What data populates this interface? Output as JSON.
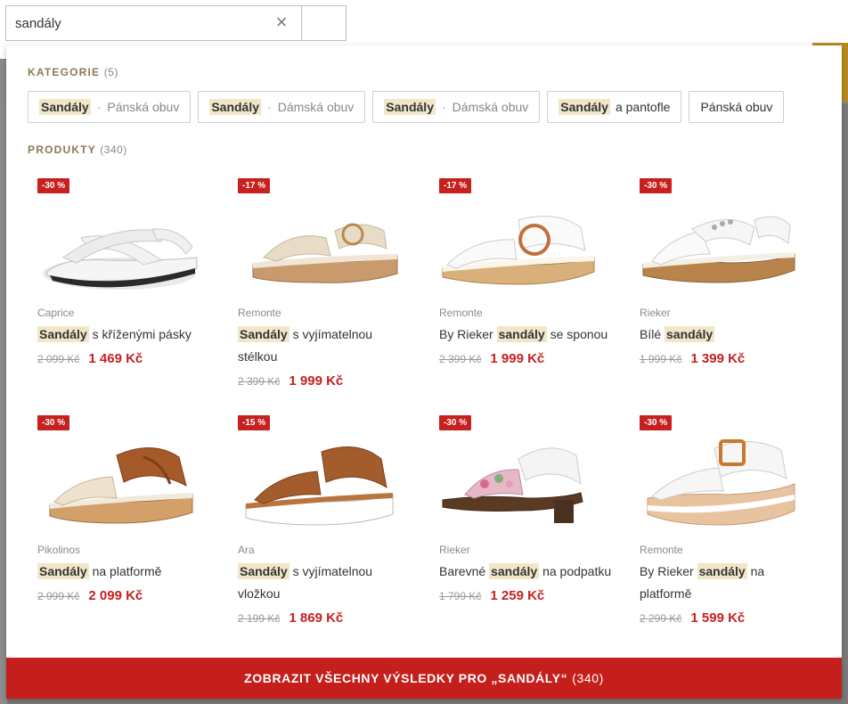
{
  "search": {
    "value": "sandály",
    "clear_icon": "×"
  },
  "categories": {
    "title": "KATEGORIE",
    "count": "(5)",
    "items": [
      {
        "highlight": "Sandály",
        "rest": "",
        "sub": "Pánská obuv"
      },
      {
        "highlight": "Sandály",
        "rest": "",
        "sub": "Dámská obuv"
      },
      {
        "highlight": "Sandály",
        "rest": "",
        "sub": "Dámská obuv"
      },
      {
        "highlight": "Sandály",
        "rest": "a pantofle",
        "sub": ""
      },
      {
        "highlight": "",
        "rest": "Pánská obuv",
        "sub": ""
      }
    ]
  },
  "products": {
    "title": "PRODUKTY",
    "count": "(340)",
    "items": [
      {
        "badge": "-30 %",
        "brand": "Caprice",
        "pre": "",
        "hl": "Sandály",
        "post": " s kříženými pásky",
        "old": "2 099 Kč",
        "new": "1 469 Kč"
      },
      {
        "badge": "-17 %",
        "brand": "Remonte",
        "pre": "",
        "hl": "Sandály",
        "post": " s vyjímatelnou stélkou",
        "old": "2 399 Kč",
        "new": "1 999 Kč"
      },
      {
        "badge": "-17 %",
        "brand": "Remonte",
        "pre": "By Rieker ",
        "hl": "sandály",
        "post": " se sponou",
        "old": "2 399 Kč",
        "new": "1 999 Kč"
      },
      {
        "badge": "-30 %",
        "brand": "Rieker",
        "pre": "Bílé ",
        "hl": "sandály",
        "post": "",
        "old": "1 999 Kč",
        "new": "1 399 Kč"
      },
      {
        "badge": "-30 %",
        "brand": "Pikolinos",
        "pre": "",
        "hl": "Sandály",
        "post": " na platformě",
        "old": "2 999 Kč",
        "new": "2 099 Kč"
      },
      {
        "badge": "-15 %",
        "brand": "Ara",
        "pre": "",
        "hl": "Sandály",
        "post": " s vyjímatelnou vložkou",
        "old": "2 199 Kč",
        "new": "1 869 Kč"
      },
      {
        "badge": "-30 %",
        "brand": "Rieker",
        "pre": "Barevné ",
        "hl": "sandály",
        "post": " na podpatku",
        "old": "1 799 Kč",
        "new": "1 259 Kč"
      },
      {
        "badge": "-30 %",
        "brand": "Remonte",
        "pre": "By Rieker ",
        "hl": "sandály",
        "post": " na platformě",
        "old": "2 299 Kč",
        "new": "1 599 Kč"
      }
    ]
  },
  "show_all": {
    "label": "ZOBRAZIT VŠECHNY VÝSLEDKY PRO „SANDÁLY“",
    "count": "(340)"
  },
  "colors": {
    "accent": "#c41f1b",
    "highlight": "#f1e6c8",
    "section_title": "#8a7a55"
  }
}
